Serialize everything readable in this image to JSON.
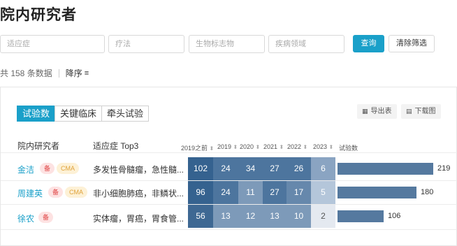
{
  "page": {
    "title": "院内研究者"
  },
  "filters": {
    "indication_placeholder": "适应症",
    "therapy_placeholder": "疗法",
    "biomarker_placeholder": "生物标志物",
    "disease_area_placeholder": "疾病领域",
    "query_label": "查询",
    "clear_label": "清除筛选"
  },
  "summary": {
    "total_text": "共 158 条数据",
    "sort_label": "降序",
    "sort_icon": "≡"
  },
  "tabs": [
    {
      "label": "试验数",
      "active": true
    },
    {
      "label": "关键临床",
      "active": false
    },
    {
      "label": "牵头试验",
      "active": false
    }
  ],
  "tools": {
    "export_label": "导出表",
    "download_label": "下载图"
  },
  "table": {
    "researcher_header": "院内研究者",
    "indication_header": "适应症 Top3",
    "year_headers": [
      "2019之前",
      "2019",
      "2020",
      "2021",
      "2022",
      "2023"
    ],
    "count_header": "试验数",
    "rows": [
      {
        "name": "金洁",
        "tags": [
          "备",
          "CMA"
        ],
        "indications": "多发性骨髓瘤，急性髓...",
        "values": [
          102,
          24,
          34,
          27,
          26,
          6
        ],
        "total": 219
      },
      {
        "name": "周建英",
        "tags": [
          "备",
          "CMA"
        ],
        "indications": "非小细胞肺癌，非鳞状...",
        "values": [
          96,
          24,
          11,
          27,
          17,
          5
        ],
        "total": 180
      },
      {
        "name": "徐农",
        "tags": [
          "备"
        ],
        "indications": "实体瘤，胃癌，胃食管...",
        "values": [
          56,
          13,
          12,
          13,
          10,
          2
        ],
        "total": 106
      }
    ]
  },
  "colors": {
    "accent": "#1aa0c9",
    "bar": "#55799f",
    "cells": [
      [
        "#35628f",
        "#4d759e",
        "#4d759e",
        "#4d759e",
        "#4d759e",
        "#8aa4c2"
      ],
      [
        "#35628f",
        "#4d759e",
        "#7d9ab9",
        "#4d759e",
        "#6688ac",
        "#b4c6da"
      ],
      [
        "#3e6893",
        "#7d9ab9",
        "#7d9ab9",
        "#7d9ab9",
        "#7d9ab9",
        "#e4e9f0"
      ]
    ]
  }
}
